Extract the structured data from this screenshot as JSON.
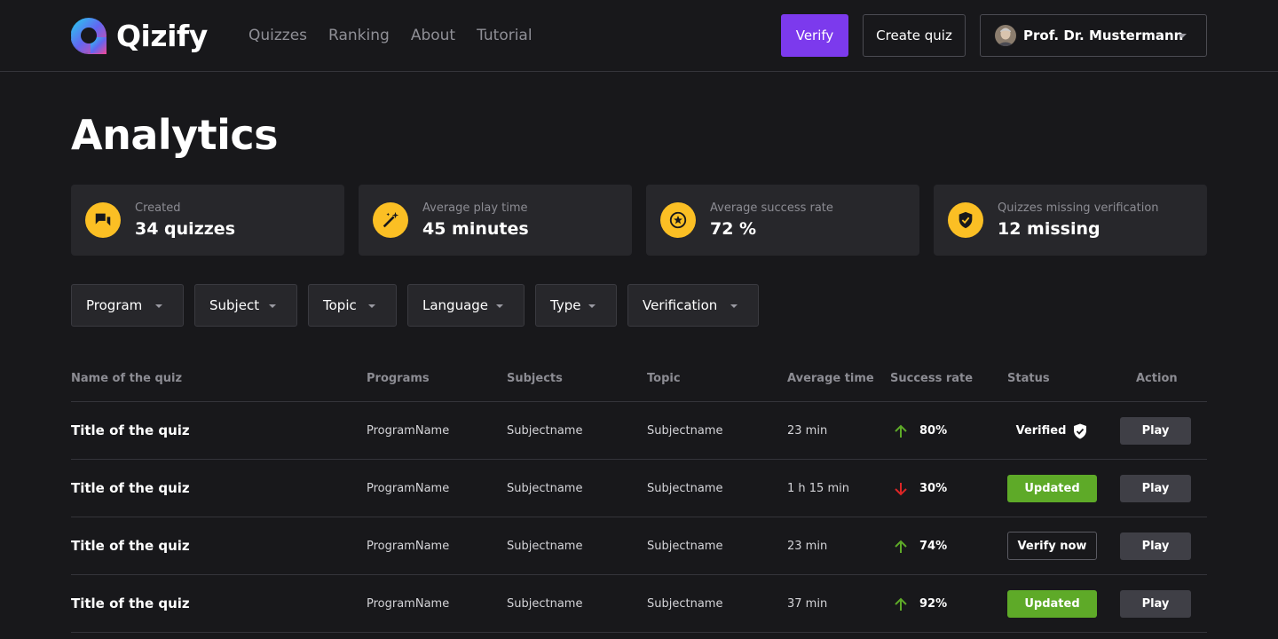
{
  "app": {
    "name": "Qizify",
    "nav": [
      {
        "label": "Quizzes"
      },
      {
        "label": "Ranking"
      },
      {
        "label": "About"
      },
      {
        "label": "Tutorial"
      }
    ],
    "verify_label": "Verify",
    "create_label": "Create quiz",
    "user_name": "Prof. Dr. Mustermann",
    "colors": {
      "accent": "#7c3aed",
      "stat_icon": "#fbbf24",
      "updated": "#5eaa28",
      "up_arrow": "#5eaa28",
      "down_arrow": "#dc2626"
    }
  },
  "page": {
    "title": "Analytics"
  },
  "stats": [
    {
      "label": "Created",
      "value": "34 quizzes",
      "icon": "chat-bubbles-icon"
    },
    {
      "label": "Average play time",
      "value": "45 minutes",
      "icon": "magic-wand-icon"
    },
    {
      "label": "Average success rate",
      "value": "72 %",
      "icon": "star-icon"
    },
    {
      "label": "Quizzes missing verification",
      "value": "12 missing",
      "icon": "shield-check-icon"
    }
  ],
  "filters": [
    {
      "label": "Program"
    },
    {
      "label": "Subject"
    },
    {
      "label": "Topic"
    },
    {
      "label": "Language"
    },
    {
      "label": "Type"
    },
    {
      "label": "Verification"
    }
  ],
  "table": {
    "headers": {
      "name": "Name of the quiz",
      "programs": "Programs",
      "subjects": "Subjects",
      "topic": "Topic",
      "avg_time": "Average time",
      "success_rate": "Success rate",
      "status": "Status",
      "action": "Action"
    },
    "rows": [
      {
        "title": "Title of the quiz",
        "program": "ProgramName",
        "subject": "Subjectname",
        "topic": "Subjectname",
        "time": "23 min",
        "trend": "up",
        "rate": "80%",
        "status": "Verified",
        "action": "Play"
      },
      {
        "title": "Title of the quiz",
        "program": "ProgramName",
        "subject": "Subjectname",
        "topic": "Subjectname",
        "time": "1 h 15 min",
        "trend": "down",
        "rate": "30%",
        "status": "Updated",
        "action": "Play"
      },
      {
        "title": "Title of the quiz",
        "program": "ProgramName",
        "subject": "Subjectname",
        "topic": "Subjectname",
        "time": "23 min",
        "trend": "up",
        "rate": "74%",
        "status": "Verify now",
        "action": "Play"
      },
      {
        "title": "Title of the quiz",
        "program": "ProgramName",
        "subject": "Subjectname",
        "topic": "Subjectname",
        "time": "37 min",
        "trend": "up",
        "rate": "92%",
        "status": "Updated",
        "action": "Play"
      }
    ]
  }
}
